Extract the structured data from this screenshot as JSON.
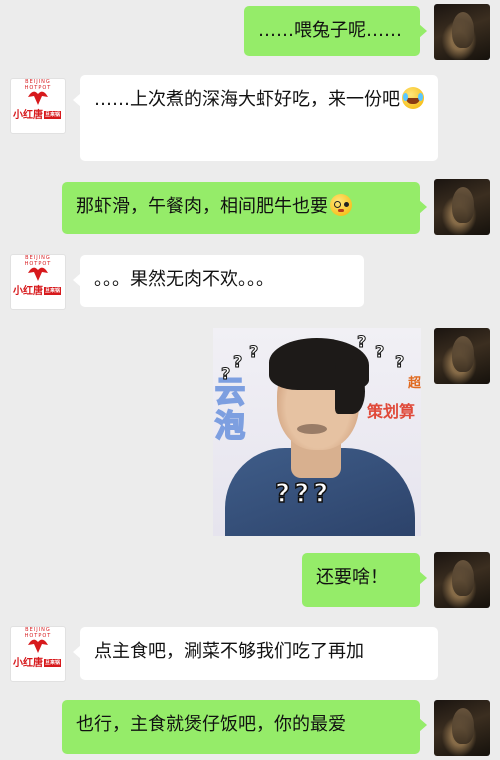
{
  "messages": [
    {
      "side": "me",
      "text": "……喂兔子呢……"
    },
    {
      "side": "them",
      "text": "……上次煮的深海大虾好吃，来一份吧"
    },
    {
      "side": "me",
      "text": "那虾滑，午餐肉，相间肥牛也要"
    },
    {
      "side": "them",
      "text": "。。。果然无肉不欢。。。"
    },
    {
      "side": "me",
      "type": "sticker",
      "question_marks": "???"
    },
    {
      "side": "me",
      "text": "还要啥！"
    },
    {
      "side": "them",
      "text": "点主食吧，涮菜不够我们吃了再加"
    },
    {
      "side": "me",
      "text": "也行，主食就煲仔饭吧，你的最爱"
    }
  ],
  "contact_logo": {
    "name": "小红唐",
    "tag": "旦来锅",
    "arc": "BEIJING HOTPOT"
  },
  "sticker_text": {
    "left": "云\n泡",
    "right": "策划算",
    "corner": "超"
  },
  "emoji": {
    "laugh": "laughing-tears-emoji",
    "flush": "flushed-emoji"
  },
  "colors": {
    "me_bubble": "#95ec69",
    "them_bubble": "#ffffff",
    "background": "#ececec",
    "logo_red": "#d7191c"
  }
}
